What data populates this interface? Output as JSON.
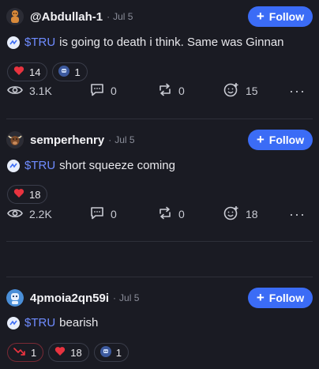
{
  "posts": [
    {
      "username": "@Abdullah-1",
      "date": "Jul 5",
      "follow_label": "Follow",
      "ticker": "$TRU",
      "text": "is going to death i think. Same was Ginnan",
      "reactions": [
        {
          "icon": "heart-icon",
          "count": "14"
        },
        {
          "icon": "robot-emoji-icon",
          "count": "1"
        }
      ],
      "stats": {
        "views": "3.1K",
        "comments": "0",
        "reposts": "0",
        "emoji": "15"
      }
    },
    {
      "username": "semperhenry",
      "date": "Jul 5",
      "follow_label": "Follow",
      "ticker": "$TRU",
      "text": "short squeeze coming",
      "reactions": [
        {
          "icon": "heart-icon",
          "count": "18"
        }
      ],
      "stats": {
        "views": "2.2K",
        "comments": "0",
        "reposts": "0",
        "emoji": "18"
      }
    },
    {
      "username": "4pmoia2qn59i",
      "date": "Jul 5",
      "follow_label": "Follow",
      "ticker": "$TRU",
      "text": "bearish",
      "reactions": [
        {
          "icon": "bearish-trend-icon",
          "count": "1"
        },
        {
          "icon": "heart-icon",
          "count": "18"
        },
        {
          "icon": "robot-emoji-icon",
          "count": "1"
        }
      ]
    }
  ],
  "colors": {
    "accent": "#3b6cf6",
    "ticker": "#6f8cff",
    "heart": "#e8333f",
    "background": "#1a1b23"
  }
}
